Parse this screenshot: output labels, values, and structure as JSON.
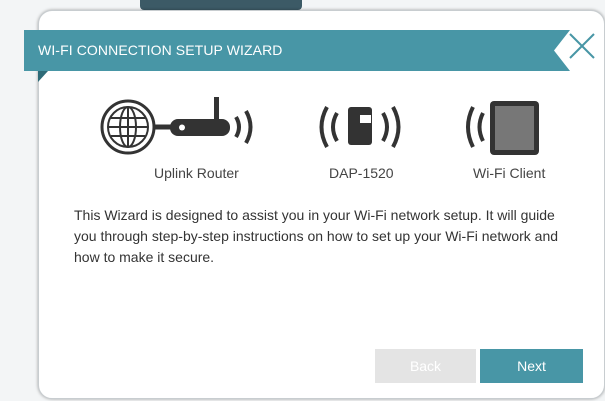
{
  "colors": {
    "accent": "#4896a6",
    "ribbon": "#4896a6",
    "ribbon_dark": "#2e6b78",
    "disabled_button": "#e4e4e4",
    "icon_dark": "#333333"
  },
  "wizard": {
    "title": "WI-FI CONNECTION SETUP WIZARD",
    "close_icon": "close-icon",
    "diagram": [
      {
        "label": "Uplink Router",
        "icon": "uplink-router-icon"
      },
      {
        "label": "DAP-1520",
        "icon": "extender-icon"
      },
      {
        "label": "Wi-Fi Client",
        "icon": "tablet-client-icon"
      }
    ],
    "description": "This Wizard is designed to assist you in your Wi-Fi network setup. It will guide you through step-by-step instructions on how to set up your Wi-Fi network and how to make it secure.",
    "buttons": {
      "back": "Back",
      "next": "Next"
    }
  }
}
